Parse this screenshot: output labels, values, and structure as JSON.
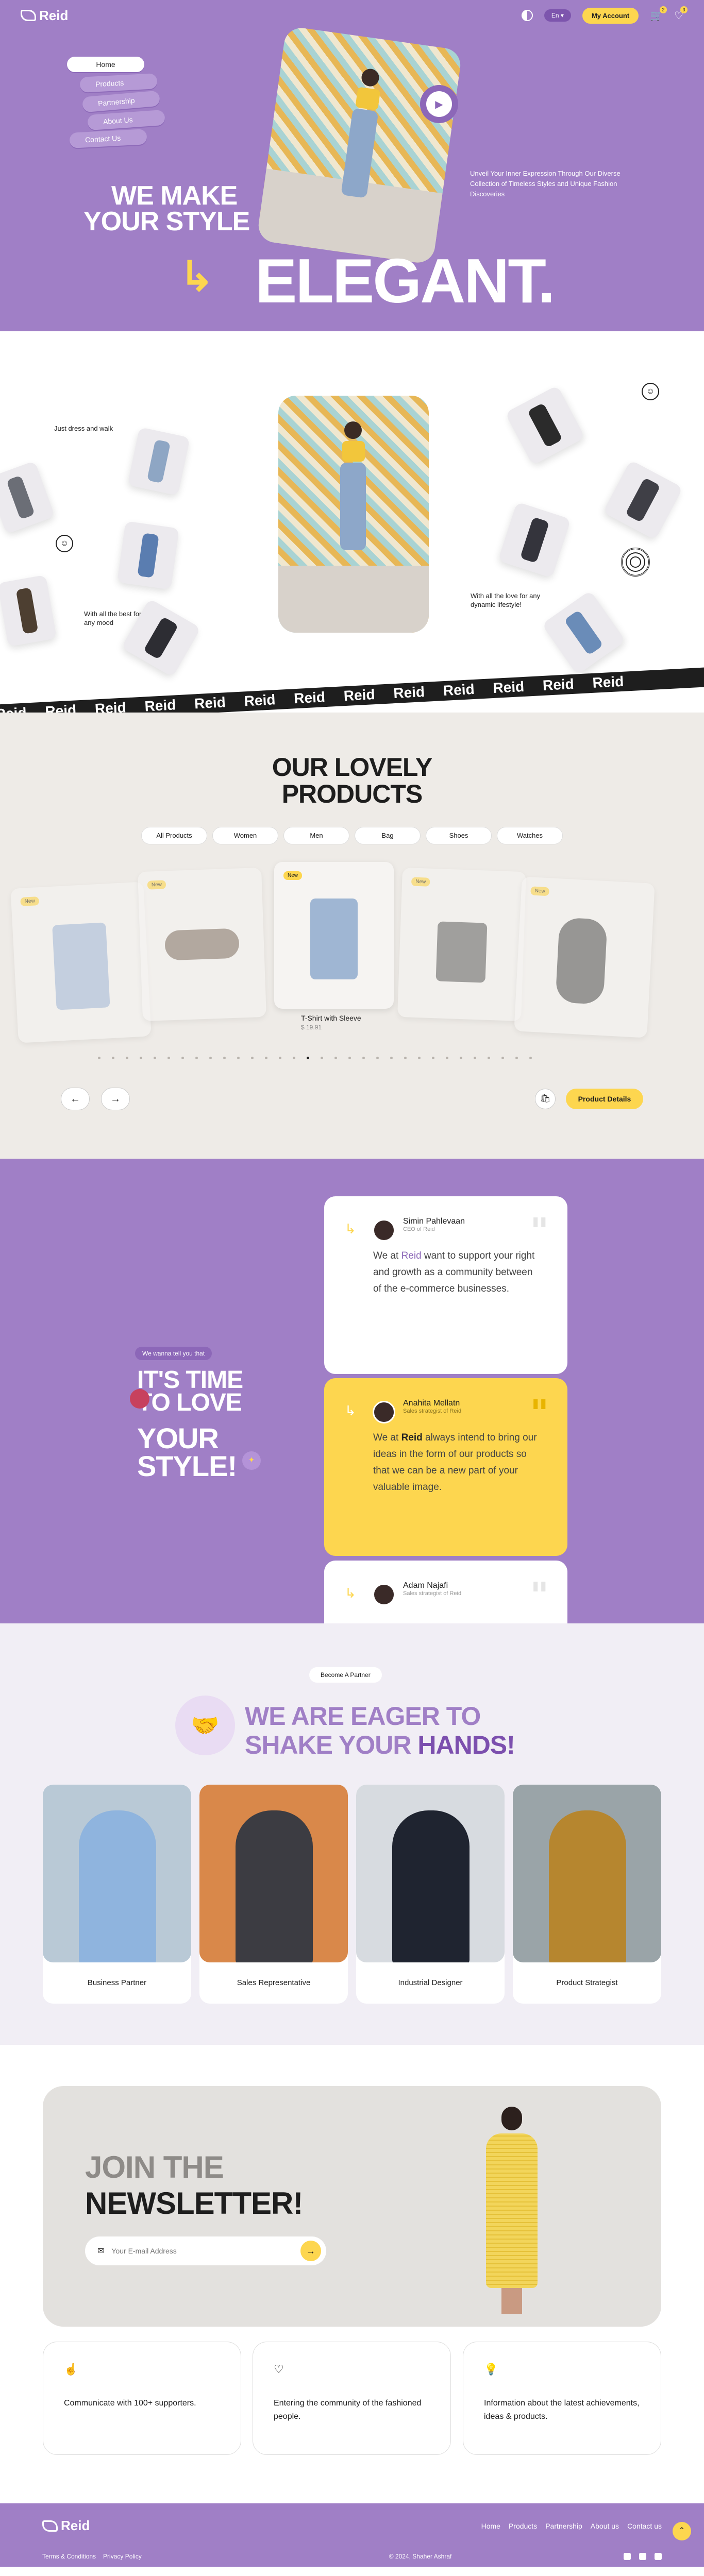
{
  "brand": {
    "name": "Reid"
  },
  "header": {
    "lang": "En ▾",
    "my_account": "My Account",
    "cart_count": "2",
    "wish_count": "3",
    "icons": [
      "theme-toggle-icon",
      "cart-icon",
      "heart-icon"
    ]
  },
  "hero": {
    "nav": [
      "Home",
      "Products",
      "Partnership",
      "About Us",
      "Contact Us"
    ],
    "description": "Unveil Your Inner Expression Through Our Diverse Collection of Timeless Styles and Unique Fashion Discoveries",
    "title_line1": "WE MAKE",
    "title_line2": "YOUR STYLE",
    "title_big": "ELEGANT."
  },
  "lifestyle": {
    "text1": "Just dress and walk",
    "text2": "With all the best for any mood",
    "text3": "With all the love for any dynamic lifestyle!"
  },
  "marquee": {
    "items": [
      "Reid",
      "Reid",
      "Reid",
      "Reid",
      "Reid",
      "Reid",
      "Reid",
      "Reid",
      "Reid",
      "Reid",
      "Reid",
      "Reid",
      "Reid"
    ]
  },
  "products": {
    "title_line1": "OUR LOVELY",
    "title_line2": "PRODUCTS",
    "filters": [
      "All Products",
      "Women",
      "Men",
      "Bag",
      "Shoes",
      "Watches"
    ],
    "new_badge": "New",
    "active_name": "T-Shirt with Sleeve",
    "active_price": "$ 19.91",
    "details_button": "Product Details",
    "prev": "←",
    "next": "→"
  },
  "testimonials": {
    "tag": "We wanna tell you that",
    "title_line1": "IT'S TIME",
    "title_line2": "TO LOVE",
    "title_line3": "YOUR",
    "title_line4": "STYLE!",
    "items": [
      {
        "name": "Simin Pahlevaan",
        "role": "CEO of Reid",
        "pre": "We at ",
        "brand": "Reid",
        "post": " want to support your right and growth as a community between of the e-commerce businesses."
      },
      {
        "name": "Anahita Mellatn",
        "role": "Sales strategist of Reid",
        "pre": "We at ",
        "brand": "Reid",
        "post": " always intend to bring our ideas in the form of our products so that we can be a new part of your valuable image."
      },
      {
        "name": "Adam Najafi",
        "role": "Sales strategist of Reid",
        "pre": "",
        "brand": "",
        "post": ""
      }
    ]
  },
  "partners": {
    "tag": "Become A Partner",
    "title_line1": "WE ARE EAGER TO",
    "title_line2a": "SHAKE YOUR ",
    "title_line2b": "HANDS!",
    "cards": [
      "Business Partner",
      "Sales Representative",
      "Industrial Designer",
      "Product Strategist"
    ]
  },
  "newsletter": {
    "title_line1": "JOIN THE",
    "title_line2": "NEWSLETTER!",
    "placeholder": "Your E-mail Address",
    "features": [
      "Communicate with 100+ supporters.",
      "Entering the community of the fashioned people.",
      "Information about the latest achievements, ideas & products."
    ]
  },
  "footer": {
    "links": [
      "Home",
      "Products",
      "Partnership",
      "About us",
      "Contact us"
    ],
    "terms": "Terms & Conditions",
    "privacy": "Privacy Policy",
    "copyright": "© 2024, Shaher Ashraf"
  },
  "colors": {
    "primary": "#a07fc6",
    "accent": "#fdd64f",
    "dark": "#1e1e1e"
  }
}
